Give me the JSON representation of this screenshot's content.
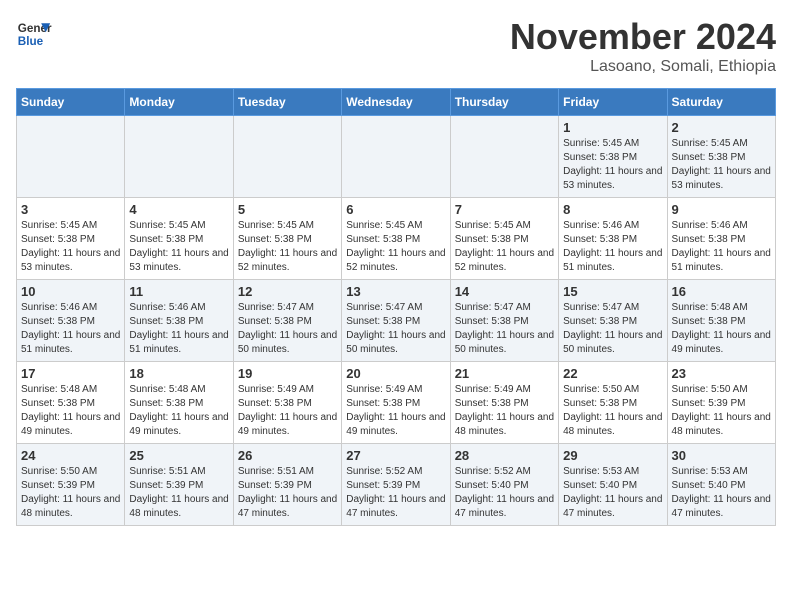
{
  "logo": {
    "line1": "General",
    "line2": "Blue"
  },
  "title": "November 2024",
  "location": "Lasoano, Somali, Ethiopia",
  "days_of_week": [
    "Sunday",
    "Monday",
    "Tuesday",
    "Wednesday",
    "Thursday",
    "Friday",
    "Saturday"
  ],
  "weeks": [
    [
      {
        "num": "",
        "info": ""
      },
      {
        "num": "",
        "info": ""
      },
      {
        "num": "",
        "info": ""
      },
      {
        "num": "",
        "info": ""
      },
      {
        "num": "",
        "info": ""
      },
      {
        "num": "1",
        "info": "Sunrise: 5:45 AM\nSunset: 5:38 PM\nDaylight: 11 hours and 53 minutes."
      },
      {
        "num": "2",
        "info": "Sunrise: 5:45 AM\nSunset: 5:38 PM\nDaylight: 11 hours and 53 minutes."
      }
    ],
    [
      {
        "num": "3",
        "info": "Sunrise: 5:45 AM\nSunset: 5:38 PM\nDaylight: 11 hours and 53 minutes."
      },
      {
        "num": "4",
        "info": "Sunrise: 5:45 AM\nSunset: 5:38 PM\nDaylight: 11 hours and 53 minutes."
      },
      {
        "num": "5",
        "info": "Sunrise: 5:45 AM\nSunset: 5:38 PM\nDaylight: 11 hours and 52 minutes."
      },
      {
        "num": "6",
        "info": "Sunrise: 5:45 AM\nSunset: 5:38 PM\nDaylight: 11 hours and 52 minutes."
      },
      {
        "num": "7",
        "info": "Sunrise: 5:45 AM\nSunset: 5:38 PM\nDaylight: 11 hours and 52 minutes."
      },
      {
        "num": "8",
        "info": "Sunrise: 5:46 AM\nSunset: 5:38 PM\nDaylight: 11 hours and 51 minutes."
      },
      {
        "num": "9",
        "info": "Sunrise: 5:46 AM\nSunset: 5:38 PM\nDaylight: 11 hours and 51 minutes."
      }
    ],
    [
      {
        "num": "10",
        "info": "Sunrise: 5:46 AM\nSunset: 5:38 PM\nDaylight: 11 hours and 51 minutes."
      },
      {
        "num": "11",
        "info": "Sunrise: 5:46 AM\nSunset: 5:38 PM\nDaylight: 11 hours and 51 minutes."
      },
      {
        "num": "12",
        "info": "Sunrise: 5:47 AM\nSunset: 5:38 PM\nDaylight: 11 hours and 50 minutes."
      },
      {
        "num": "13",
        "info": "Sunrise: 5:47 AM\nSunset: 5:38 PM\nDaylight: 11 hours and 50 minutes."
      },
      {
        "num": "14",
        "info": "Sunrise: 5:47 AM\nSunset: 5:38 PM\nDaylight: 11 hours and 50 minutes."
      },
      {
        "num": "15",
        "info": "Sunrise: 5:47 AM\nSunset: 5:38 PM\nDaylight: 11 hours and 50 minutes."
      },
      {
        "num": "16",
        "info": "Sunrise: 5:48 AM\nSunset: 5:38 PM\nDaylight: 11 hours and 49 minutes."
      }
    ],
    [
      {
        "num": "17",
        "info": "Sunrise: 5:48 AM\nSunset: 5:38 PM\nDaylight: 11 hours and 49 minutes."
      },
      {
        "num": "18",
        "info": "Sunrise: 5:48 AM\nSunset: 5:38 PM\nDaylight: 11 hours and 49 minutes."
      },
      {
        "num": "19",
        "info": "Sunrise: 5:49 AM\nSunset: 5:38 PM\nDaylight: 11 hours and 49 minutes."
      },
      {
        "num": "20",
        "info": "Sunrise: 5:49 AM\nSunset: 5:38 PM\nDaylight: 11 hours and 49 minutes."
      },
      {
        "num": "21",
        "info": "Sunrise: 5:49 AM\nSunset: 5:38 PM\nDaylight: 11 hours and 48 minutes."
      },
      {
        "num": "22",
        "info": "Sunrise: 5:50 AM\nSunset: 5:38 PM\nDaylight: 11 hours and 48 minutes."
      },
      {
        "num": "23",
        "info": "Sunrise: 5:50 AM\nSunset: 5:39 PM\nDaylight: 11 hours and 48 minutes."
      }
    ],
    [
      {
        "num": "24",
        "info": "Sunrise: 5:50 AM\nSunset: 5:39 PM\nDaylight: 11 hours and 48 minutes."
      },
      {
        "num": "25",
        "info": "Sunrise: 5:51 AM\nSunset: 5:39 PM\nDaylight: 11 hours and 48 minutes."
      },
      {
        "num": "26",
        "info": "Sunrise: 5:51 AM\nSunset: 5:39 PM\nDaylight: 11 hours and 47 minutes."
      },
      {
        "num": "27",
        "info": "Sunrise: 5:52 AM\nSunset: 5:39 PM\nDaylight: 11 hours and 47 minutes."
      },
      {
        "num": "28",
        "info": "Sunrise: 5:52 AM\nSunset: 5:40 PM\nDaylight: 11 hours and 47 minutes."
      },
      {
        "num": "29",
        "info": "Sunrise: 5:53 AM\nSunset: 5:40 PM\nDaylight: 11 hours and 47 minutes."
      },
      {
        "num": "30",
        "info": "Sunrise: 5:53 AM\nSunset: 5:40 PM\nDaylight: 11 hours and 47 minutes."
      }
    ]
  ]
}
